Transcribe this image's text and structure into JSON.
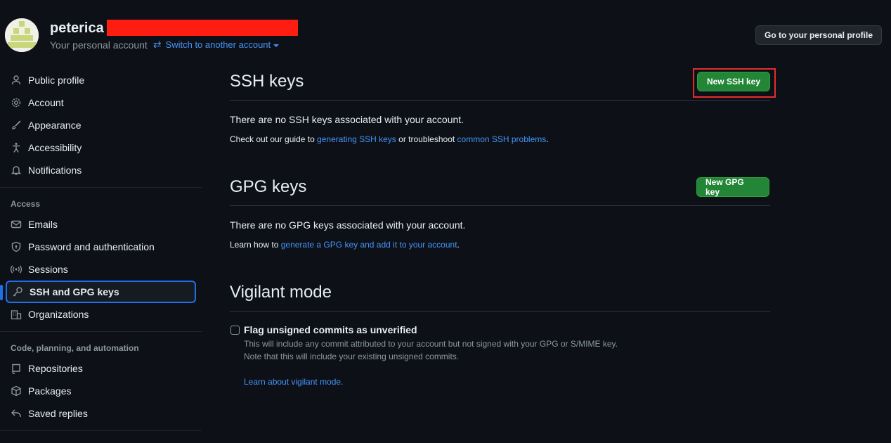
{
  "header": {
    "user_name": "peterica",
    "account_label": "Your personal account",
    "switch_label": "Switch to another account",
    "profile_button": "Go to your personal profile"
  },
  "sidebar": {
    "items_top": [
      {
        "label": "Public profile",
        "icon": "person-icon"
      },
      {
        "label": "Account",
        "icon": "gear-icon"
      },
      {
        "label": "Appearance",
        "icon": "paintbrush-icon"
      },
      {
        "label": "Accessibility",
        "icon": "accessibility-icon"
      },
      {
        "label": "Notifications",
        "icon": "bell-icon"
      }
    ],
    "access_heading": "Access",
    "items_access": [
      {
        "label": "Emails",
        "icon": "mail-icon"
      },
      {
        "label": "Password and authentication",
        "icon": "shield-icon"
      },
      {
        "label": "Sessions",
        "icon": "broadcast-icon"
      },
      {
        "label": "SSH and GPG keys",
        "icon": "key-icon"
      },
      {
        "label": "Organizations",
        "icon": "organization-icon"
      }
    ],
    "code_heading": "Code, planning, and automation",
    "items_code": [
      {
        "label": "Repositories",
        "icon": "repo-icon"
      },
      {
        "label": "Packages",
        "icon": "package-icon"
      },
      {
        "label": "Saved replies",
        "icon": "reply-icon"
      }
    ]
  },
  "ssh": {
    "title": "SSH keys",
    "button": "New SSH key",
    "empty": "There are no SSH keys associated with your account.",
    "guide_prefix": "Check out our guide to ",
    "guide_link1": "generating SSH keys",
    "guide_mid": " or troubleshoot ",
    "guide_link2": "common SSH problems",
    "guide_suffix": "."
  },
  "gpg": {
    "title": "GPG keys",
    "button": "New GPG key",
    "empty": "There are no GPG keys associated with your account.",
    "learn_prefix": "Learn how to ",
    "learn_link": "generate a GPG key and add it to your account",
    "learn_suffix": "."
  },
  "vigilant": {
    "title": "Vigilant mode",
    "checkbox_label": "Flag unsigned commits as unverified",
    "checked": false,
    "desc1": "This will include any commit attributed to your account but not signed with your GPG or S/MIME key.",
    "desc2": "Note that this will include your existing unsigned commits.",
    "learn_link": "Learn about vigilant mode."
  },
  "colors": {
    "background": "#0d1117",
    "link": "#4493f8",
    "button_green": "#238636",
    "highlight_red": "#e22d2d",
    "redaction_red": "#ff1c10"
  }
}
